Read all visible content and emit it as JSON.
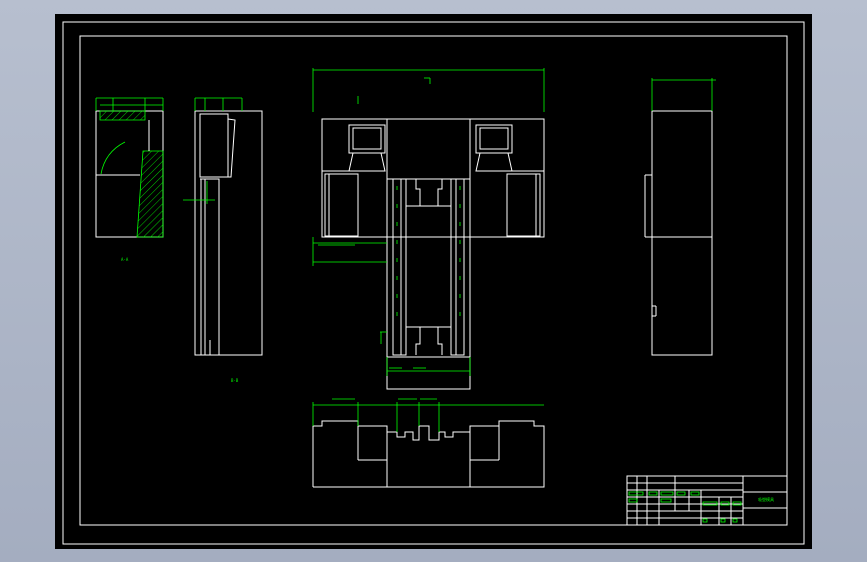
{
  "drawing": {
    "colors": {
      "outline": "#ffffff",
      "dimension": "#00ff00",
      "background": "#000000",
      "workspace": "#a9b1c3"
    },
    "labels": {
      "section_label_left": "A-A",
      "section_label_side": "B-B"
    },
    "title_block": {
      "drawing_title": "吸塑模具"
    }
  }
}
